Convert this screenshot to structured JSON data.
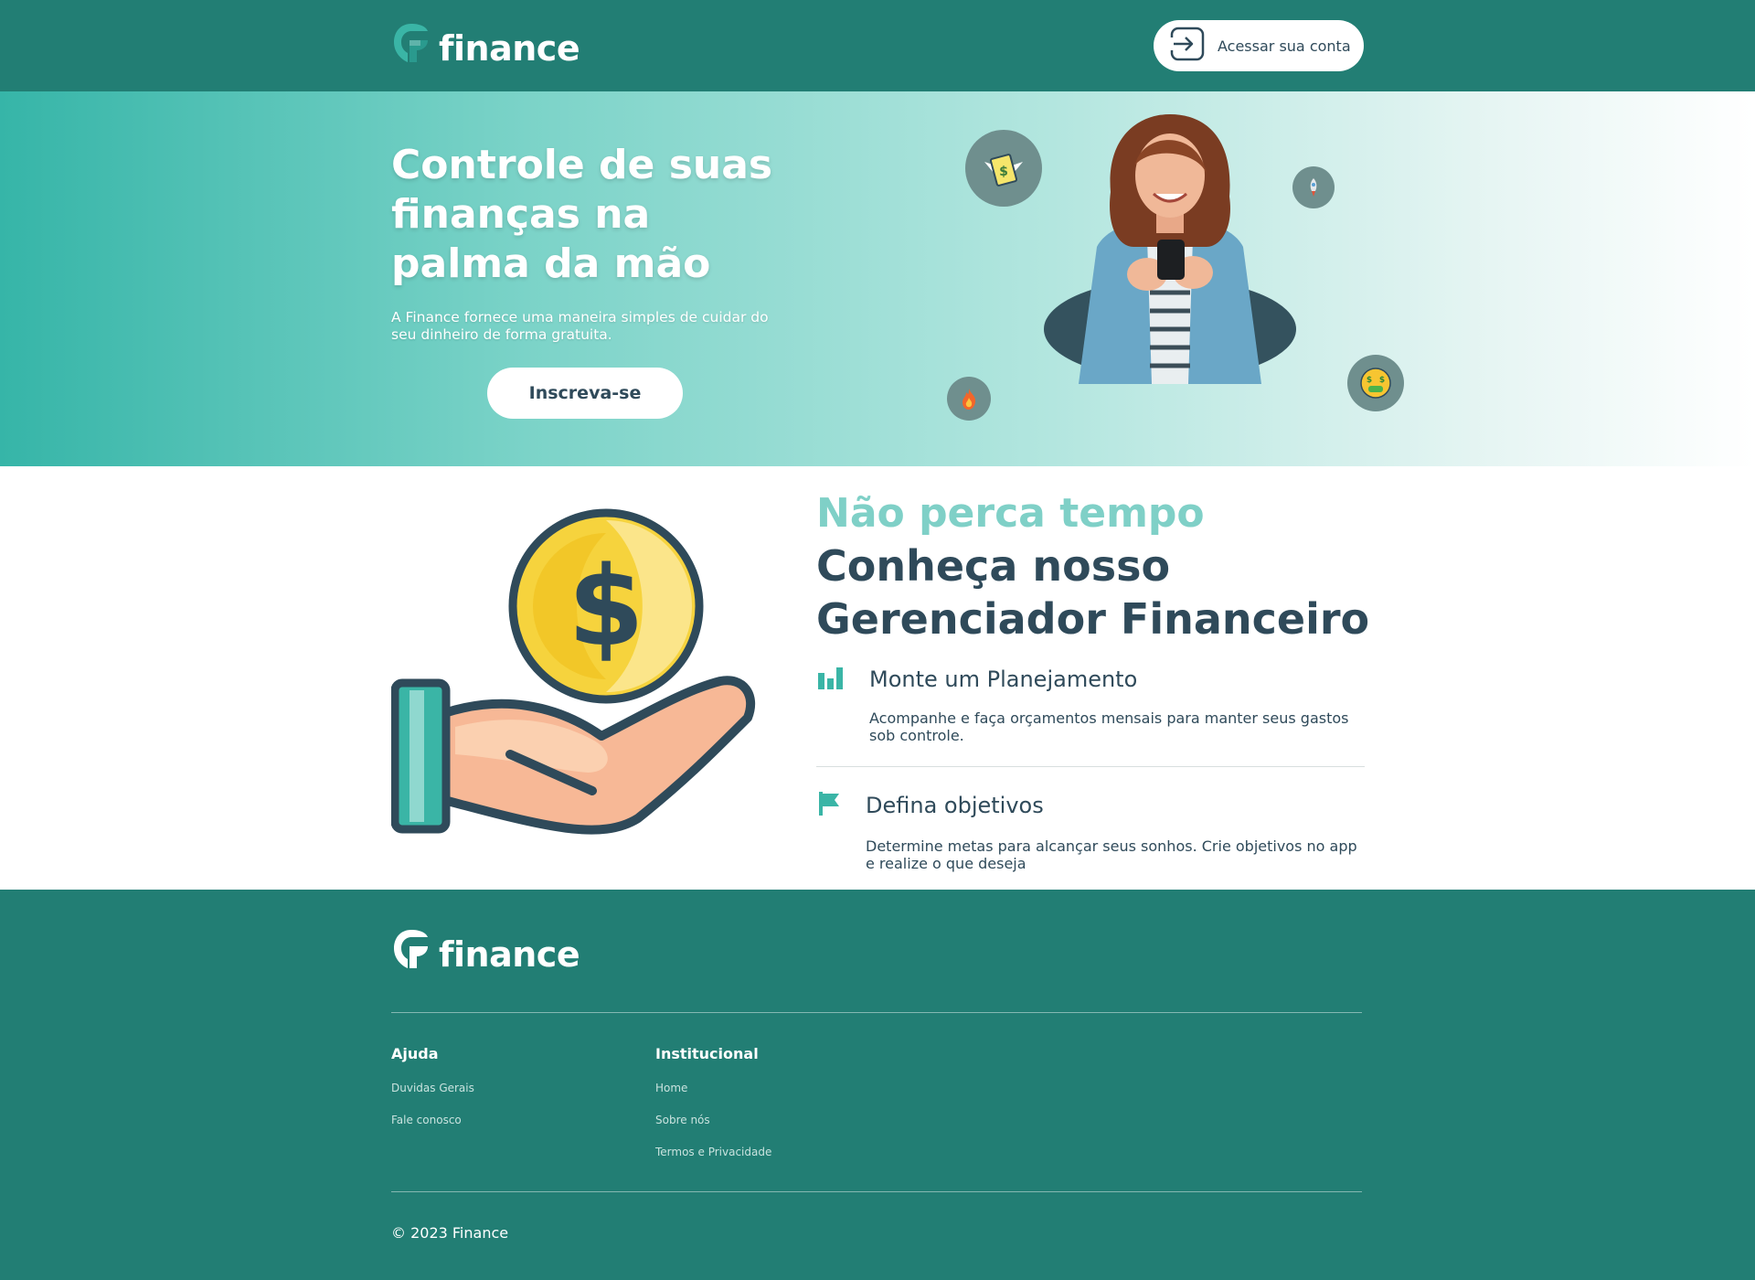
{
  "header": {
    "brand": "finance",
    "login_label": "Acessar sua conta"
  },
  "hero": {
    "title": "Controle de suas finanças na palma da mão",
    "subtitle": "A Finance fornece uma maneira simples de cuidar do seu dinheiro de forma gratuita.",
    "cta_label": "Inscreva-se",
    "emoji_icons": [
      "money-with-wings-icon",
      "rocket-icon",
      "fire-icon",
      "money-mouth-face-icon"
    ]
  },
  "features": {
    "kicker": "Não perca tempo",
    "title": "Conheça nosso Gerenciador Financeiro",
    "items": [
      {
        "icon": "bar-chart-icon",
        "title": "Monte um Planejamento",
        "desc": "Acompanhe e faça orçamentos mensais para manter seus gastos sob controle."
      },
      {
        "icon": "flag-icon",
        "title": "Defina objetivos",
        "desc": "Determine metas para alcançar seus sonhos. Crie objetivos no app e realize o que deseja"
      }
    ]
  },
  "footer": {
    "brand": "finance",
    "columns": [
      {
        "title": "Ajuda",
        "links": [
          "Duvidas Gerais",
          "Fale conosco"
        ]
      },
      {
        "title": "Institucional",
        "links": [
          "Home",
          "Sobre nós",
          "Termos e Privacidade"
        ]
      }
    ],
    "copyright": "© 2023 Finance"
  },
  "colors": {
    "primary": "#227e74",
    "accent": "#7fd0c7",
    "text": "#2f4a5a"
  }
}
